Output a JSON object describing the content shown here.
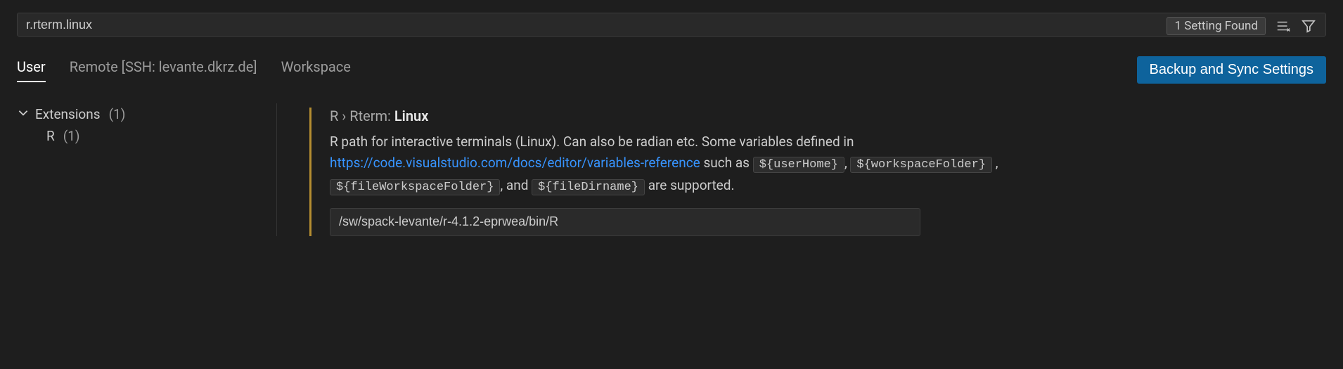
{
  "search": {
    "value": "r.rterm.linux",
    "result_badge": "1 Setting Found"
  },
  "tabs": {
    "user": "User",
    "remote": "Remote [SSH: levante.dkrz.de]",
    "workspace": "Workspace"
  },
  "sync_button": "Backup and Sync Settings",
  "sidebar": {
    "extensions_label": "Extensions",
    "extensions_count": "(1)",
    "r_label": "R",
    "r_count": "(1)"
  },
  "setting": {
    "breadcrumb_prefix": "R › Rterm: ",
    "breadcrumb_strong": "Linux",
    "desc_part1": "R path for interactive terminals (Linux). Can also be radian etc. Some variables defined in ",
    "desc_link": "https://code.visualstudio.com/docs/editor/variables-reference",
    "desc_part2": " such as ",
    "var1": "${userHome}",
    "sep1": ", ",
    "var2": "${workspaceFolder}",
    "sep2": " , ",
    "var3": "${fileWorkspaceFolder}",
    "sep3": ", and ",
    "var4": "${fileDirname}",
    "desc_part3": " are supported.",
    "value": "/sw/spack-levante/r-4.1.2-eprwea/bin/R"
  }
}
